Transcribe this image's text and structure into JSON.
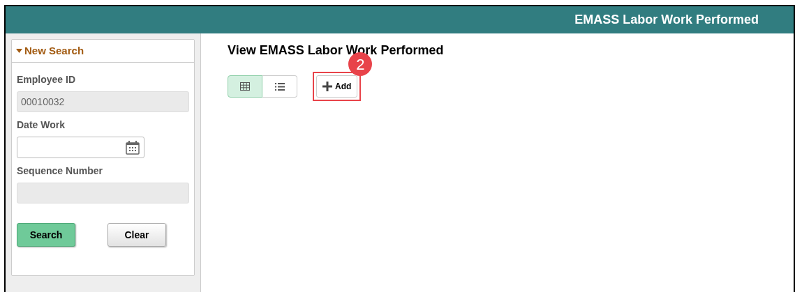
{
  "header": {
    "title": "EMASS Labor Work Performed"
  },
  "search_panel": {
    "title": "New Search",
    "expanded": true,
    "fields": [
      {
        "label": "Employee ID",
        "value": "00010032",
        "kind": "text",
        "disabled": true
      },
      {
        "label": "Date Work",
        "kind": "date",
        "disabled": false
      },
      {
        "label": "Sequence Number",
        "kind": "text",
        "disabled": true
      }
    ],
    "buttons": [
      {
        "label": "Search",
        "kind": "primary"
      },
      {
        "label": "Clear",
        "kind": "secondary"
      }
    ]
  },
  "main": {
    "title": "View EMASS Labor Work Performed",
    "view_toggles": [
      {
        "kind": "grid",
        "selected": true
      },
      {
        "kind": "list",
        "selected": false
      }
    ],
    "add_button": {
      "label": "Add",
      "highlighted": true,
      "callout": "2"
    }
  }
}
